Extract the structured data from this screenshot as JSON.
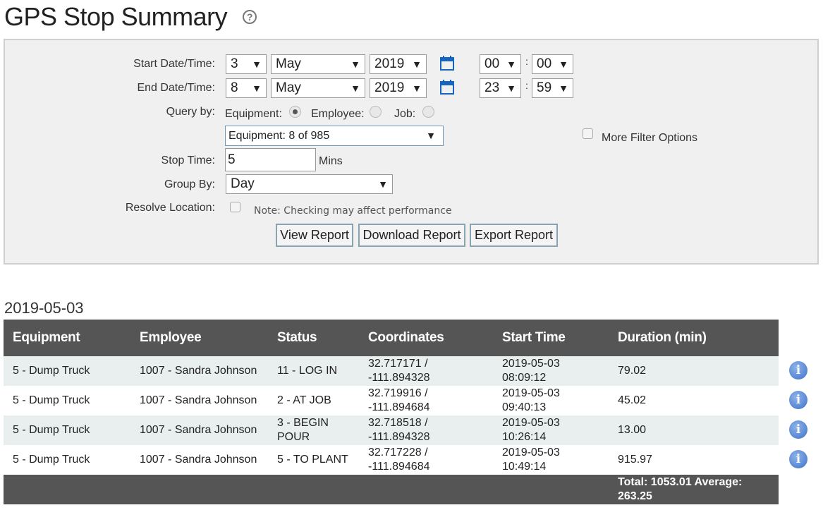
{
  "page": {
    "title": "GPS Stop Summary",
    "help_icon": "question-circle-icon"
  },
  "filters": {
    "start_label": "Start Date/Time:",
    "end_label": "End Date/Time:",
    "start": {
      "day": "3",
      "month": "May",
      "year": "2019",
      "hour": "00",
      "minute": "00"
    },
    "end": {
      "day": "8",
      "month": "May",
      "year": "2019",
      "hour": "23",
      "minute": "59"
    },
    "colon": ":",
    "query_by_label": "Query by:",
    "query_options": {
      "equipment": "Equipment:",
      "employee": "Employee:",
      "job": "Job:"
    },
    "query_selected": "equipment",
    "equipment_select": "Equipment: 8 of 985",
    "more_filter_label": "More Filter Options",
    "stop_time_label": "Stop Time:",
    "stop_time_value": "5",
    "stop_time_unit": "Mins",
    "group_by_label": "Group By:",
    "group_by_value": "Day",
    "resolve_label": "Resolve Location:",
    "resolve_note": "Note: Checking may affect performance",
    "buttons": {
      "view": "View Report",
      "download": "Download Report",
      "export": "Export Report"
    },
    "arrow_glyph": "▼"
  },
  "report": {
    "date_heading": "2019-05-03",
    "columns": [
      "Equipment",
      "Employee",
      "Status",
      "Coordinates",
      "Start Time",
      "Duration (min)"
    ],
    "rows": [
      {
        "equipment": "5 - Dump Truck",
        "employee": "1007 - Sandra Johnson",
        "status": "11 - LOG IN",
        "lat": "32.717171 /",
        "lon": "-111.894328",
        "date": "2019-05-03",
        "time": "08:09:12",
        "duration": "79.02"
      },
      {
        "equipment": "5 - Dump Truck",
        "employee": "1007 - Sandra Johnson",
        "status": "2 - AT JOB",
        "lat": "32.719916 /",
        "lon": "-111.894684",
        "date": "2019-05-03",
        "time": "09:40:13",
        "duration": "45.02"
      },
      {
        "equipment": "5 - Dump Truck",
        "employee": "1007 - Sandra Johnson",
        "status": "3 - BEGIN POUR",
        "lat": "32.718518 /",
        "lon": "-111.894328",
        "date": "2019-05-03",
        "time": "10:26:14",
        "duration": "13.00"
      },
      {
        "equipment": "5 - Dump Truck",
        "employee": "1007 - Sandra Johnson",
        "status": "5 - TO PLANT",
        "lat": "32.717228 /",
        "lon": "-111.894684",
        "date": "2019-05-03",
        "time": "10:49:14",
        "duration": "915.97"
      }
    ],
    "total_text": "Total: 1053.01 Average: 263.25",
    "info_glyph": "i"
  },
  "colors": {
    "header_bg": "#555555",
    "row_alt": "#e9eeee",
    "info_blue": "#3d71c9",
    "calendar_blue": "#1565c0"
  }
}
